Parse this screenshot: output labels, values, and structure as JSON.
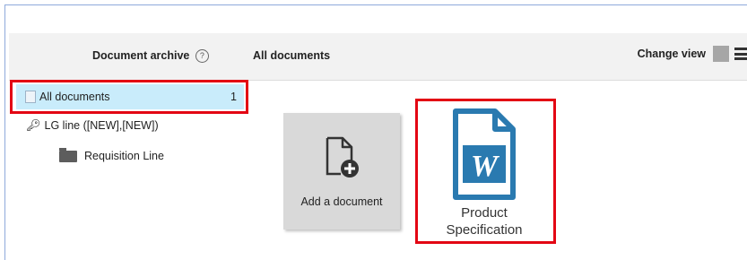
{
  "header": {
    "archive_title": "Document archive",
    "help_symbol": "?",
    "breadcrumb": "All documents",
    "change_view_label": "Change view"
  },
  "sidebar": {
    "items": [
      {
        "label": "All documents",
        "count": "1",
        "icon": "documents-icon"
      },
      {
        "label": "LG line ([NEW],[NEW])",
        "icon": "key-icon"
      },
      {
        "label": "Requisition Line",
        "icon": "folder-icon"
      }
    ]
  },
  "tiles": {
    "add": {
      "label": "Add a document",
      "icon": "add-document-icon"
    },
    "doc": {
      "name_line1": "Product",
      "name_line2": "Specification",
      "icon_letter": "W",
      "icon": "word-document-icon"
    }
  },
  "colors": {
    "highlight_box": "#e30613",
    "active_item_bg": "#c9ecfb",
    "word_blue": "#2a7ab0",
    "tile_gray": "#d9d9d9"
  }
}
